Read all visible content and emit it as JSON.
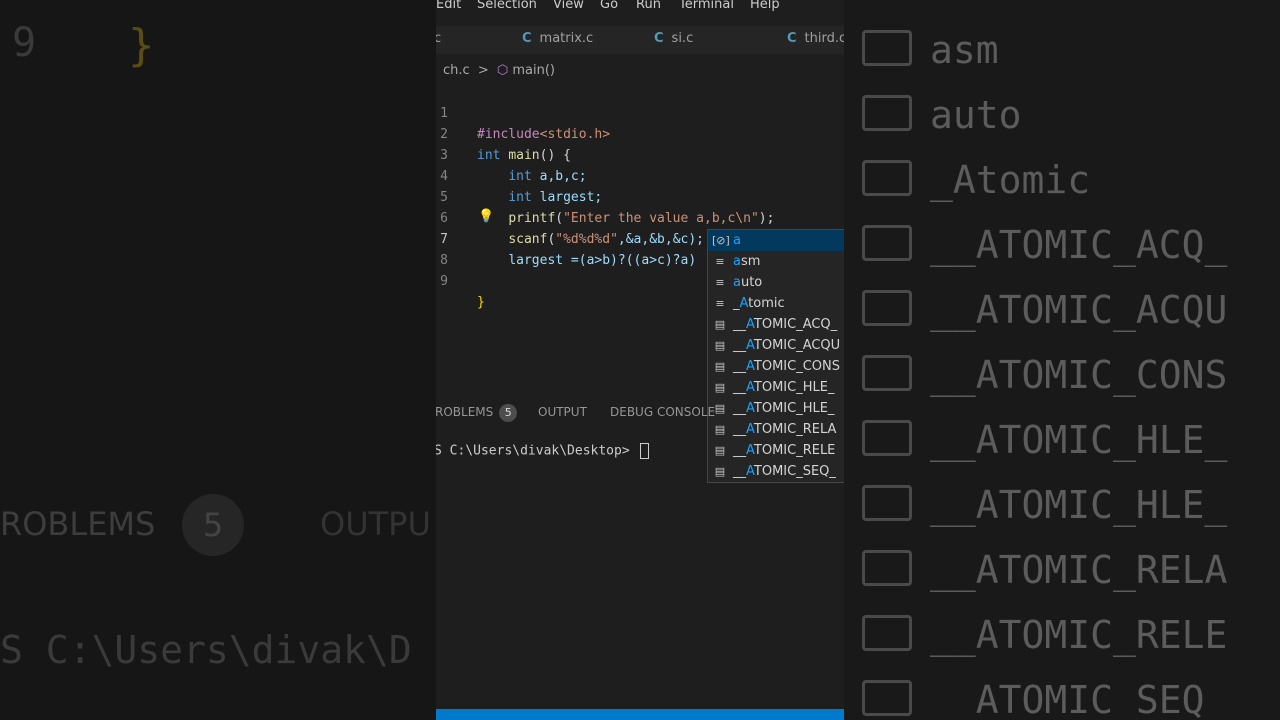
{
  "menu": [
    "Edit",
    "Selection",
    "View",
    "Go",
    "Run",
    "Terminal",
    "Help"
  ],
  "tabs": [
    {
      "icon": "C",
      "label": "c"
    },
    {
      "icon": "C",
      "label": "matrix.c"
    },
    {
      "icon": "C",
      "label": "si.c"
    },
    {
      "icon": "C",
      "label": "third.c"
    }
  ],
  "breadcrumb": {
    "file": "ch.c",
    "separator": ">",
    "symbol": "main()"
  },
  "code": {
    "line_numbers": [
      "1",
      "2",
      "3",
      "4",
      "5",
      "6",
      "7",
      "8",
      "9"
    ],
    "l1": {
      "pp": "#include",
      "str": "<stdio.h>"
    },
    "l2": {
      "kw": "int",
      "fn": "main",
      "rest": "() {"
    },
    "l3": {
      "kw": "int",
      "rest": "a,b,c;"
    },
    "l4": {
      "kw": "int",
      "rest": "largest;"
    },
    "l5": {
      "fn": "printf",
      "p1": "(",
      "str": "\"Enter the value a,b,c\\n\"",
      "p2": ");"
    },
    "l6": {
      "fn": "scanf",
      "p1": "(",
      "str": "\"%d%d%d\"",
      "p2": ",&a,&b,&c);"
    },
    "l7": {
      "text": "largest =(a>b)?((a>c)?a)"
    },
    "l9": {
      "brace": "}"
    }
  },
  "suggestions": [
    {
      "icon": "variable-icon",
      "glyph": "[⊘]",
      "label_hl": "a",
      "label_rest": ""
    },
    {
      "icon": "keyword-icon",
      "glyph": "≡",
      "label_hl": "a",
      "label_rest": "sm"
    },
    {
      "icon": "keyword-icon",
      "glyph": "≡",
      "label_hl": "a",
      "label_rest": "uto"
    },
    {
      "icon": "keyword-icon",
      "glyph": "≡",
      "label_pre": "_",
      "label_hl": "A",
      "label_rest": "tomic"
    },
    {
      "icon": "text-icon",
      "glyph": "▤",
      "label_pre": "__",
      "label_hl": "A",
      "label_rest": "TOMIC_ACQ_"
    },
    {
      "icon": "text-icon",
      "glyph": "▤",
      "label_pre": "__",
      "label_hl": "A",
      "label_rest": "TOMIC_ACQU"
    },
    {
      "icon": "text-icon",
      "glyph": "▤",
      "label_pre": "__",
      "label_hl": "A",
      "label_rest": "TOMIC_CONS"
    },
    {
      "icon": "text-icon",
      "glyph": "▤",
      "label_pre": "__",
      "label_hl": "A",
      "label_rest": "TOMIC_HLE_"
    },
    {
      "icon": "text-icon",
      "glyph": "▤",
      "label_pre": "__",
      "label_hl": "A",
      "label_rest": "TOMIC_HLE_"
    },
    {
      "icon": "text-icon",
      "glyph": "▤",
      "label_pre": "__",
      "label_hl": "A",
      "label_rest": "TOMIC_RELA"
    },
    {
      "icon": "text-icon",
      "glyph": "▤",
      "label_pre": "__",
      "label_hl": "A",
      "label_rest": "TOMIC_RELE"
    },
    {
      "icon": "text-icon",
      "glyph": "▤",
      "label_pre": "__",
      "label_hl": "A",
      "label_rest": "TOMIC_SEQ_"
    }
  ],
  "panel": {
    "problems_label": "ROBLEMS",
    "problems_count": "5",
    "output_label": "OUTPUT",
    "debug_label": "DEBUG CONSOLE"
  },
  "terminal": {
    "prompt": "S C:\\Users\\divak\\Desktop> "
  },
  "background": {
    "left": {
      "ln": "9",
      "brace": "}",
      "problems": "ROBLEMS",
      "count": "5",
      "output": "OUTPU",
      "path": "S C:\\Users\\divak\\D"
    },
    "right": [
      "asm",
      "auto",
      "_Atomic",
      "__ATOMIC_ACQ_",
      "__ATOMIC_ACQU",
      "__ATOMIC_CONS",
      "__ATOMIC_HLE_",
      "__ATOMIC_HLE_",
      "__ATOMIC_RELA",
      "__ATOMIC_RELE",
      "__ATOMIC_SEQ"
    ]
  },
  "colors": {
    "accent": "#007acc",
    "suggest_selected": "#04395e",
    "match_highlight": "#18a3ff"
  }
}
